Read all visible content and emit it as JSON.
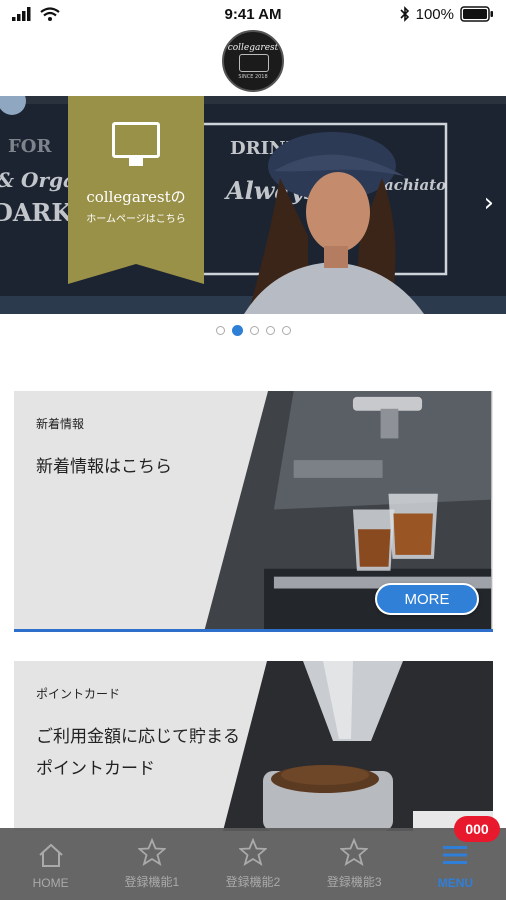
{
  "status_bar": {
    "time": "9:41 AM",
    "battery": "100%"
  },
  "header": {
    "logo_text": "collegarest",
    "logo_bottom": "SINCE 2018"
  },
  "hero": {
    "badge_title": "collegarestの",
    "badge_subtitle": "ホームページはこちら",
    "chalk_1": "& Organic",
    "chalk_2": "DARK BLEND",
    "chalk_3": "DRINKERS",
    "chalk_4": "Always",
    "chalk_5": "achiato",
    "chalk_6": "FOR",
    "slide_count": 5,
    "active_slide": 2
  },
  "cards": [
    {
      "label": "新着情報",
      "title": "新着情報はこちら",
      "button": "MORE"
    },
    {
      "label": "ポイントカード",
      "title": "ご利用金額に応じて貯まるポイントカード"
    }
  ],
  "tabbar": {
    "tabs": [
      {
        "label": "HOME",
        "icon": "home-icon"
      },
      {
        "label": "登録機能1",
        "icon": "star-icon"
      },
      {
        "label": "登録機能2",
        "icon": "star-icon"
      },
      {
        "label": "登録機能3",
        "icon": "star-icon"
      },
      {
        "label": "MENU",
        "icon": "menu-icon"
      }
    ],
    "menu_badge": "000"
  },
  "colors": {
    "accent": "#2f80d6",
    "badge_red": "#e8192c",
    "hero_badge": "#9a9148",
    "tabbar": "#5a5a5a"
  }
}
